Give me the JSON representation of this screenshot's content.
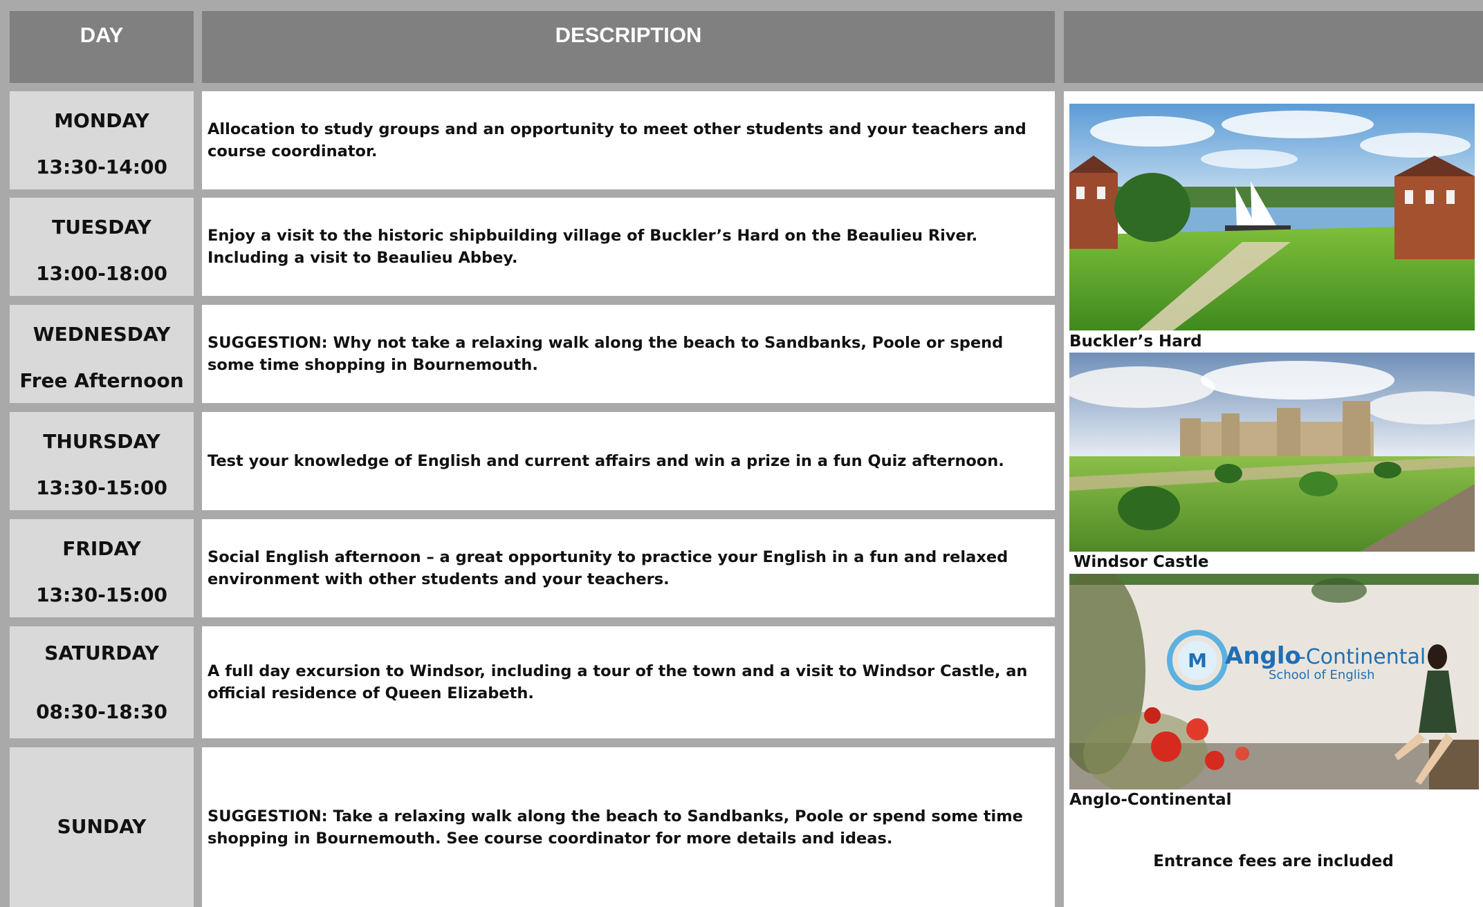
{
  "header": {
    "day_label": "DAY",
    "description_label": "DESCRIPTION",
    "image_label": ""
  },
  "rows": [
    {
      "day": "MONDAY",
      "time": "13:30-14:00",
      "description": "Allocation to study groups and an opportunity to meet other students and your teachers and course coordinator."
    },
    {
      "day": "TUESDAY",
      "time": "13:00-18:00",
      "description": "Enjoy a visit to the historic shipbuilding village of Buckler’s Hard on the Beaulieu River. Including a visit to Beaulieu Abbey."
    },
    {
      "day": "WEDNESDAY",
      "time": "Free Afternoon",
      "description": "SUGGESTION: Why not take a relaxing walk along the beach to Sandbanks, Poole or spend some time shopping in Bournemouth."
    },
    {
      "day": "THURSDAY",
      "time": "13:30-15:00",
      "description": "Test your knowledge of English and current affairs and win a prize in a fun Quiz afternoon."
    },
    {
      "day": "FRIDAY",
      "time": "13:30-15:00",
      "description": "Social English afternoon – a great opportunity to practice your English in a fun and relaxed environment with other students and your teachers."
    },
    {
      "day": "SATURDAY",
      "time": "08:30-18:30",
      "description": "A full day excursion to Windsor, including a tour of the town and a visit to Windsor Castle, an official residence of Queen Elizabeth."
    },
    {
      "day": "SUNDAY",
      "time": "",
      "description": "SUGGESTION: Take a relaxing walk along the beach to Sandbanks, Poole or spend some time shopping in Bournemouth. See course coordinator for more details and ideas."
    }
  ],
  "photos": [
    {
      "caption": "Buckler’s Hard"
    },
    {
      "caption": "Windsor Castle"
    },
    {
      "caption": "Anglo-Continental",
      "sign_word_1": "Anglo",
      "sign_word_2": "-Continental",
      "sign_subtitle": "School of English"
    }
  ],
  "footer_note": "Entrance fees are included",
  "colors": {
    "header_bg": "#808080",
    "day_cell_bg": "#d9d9d9",
    "grid": "#a9a9a9",
    "logo_blue": "#1f6fb5"
  }
}
